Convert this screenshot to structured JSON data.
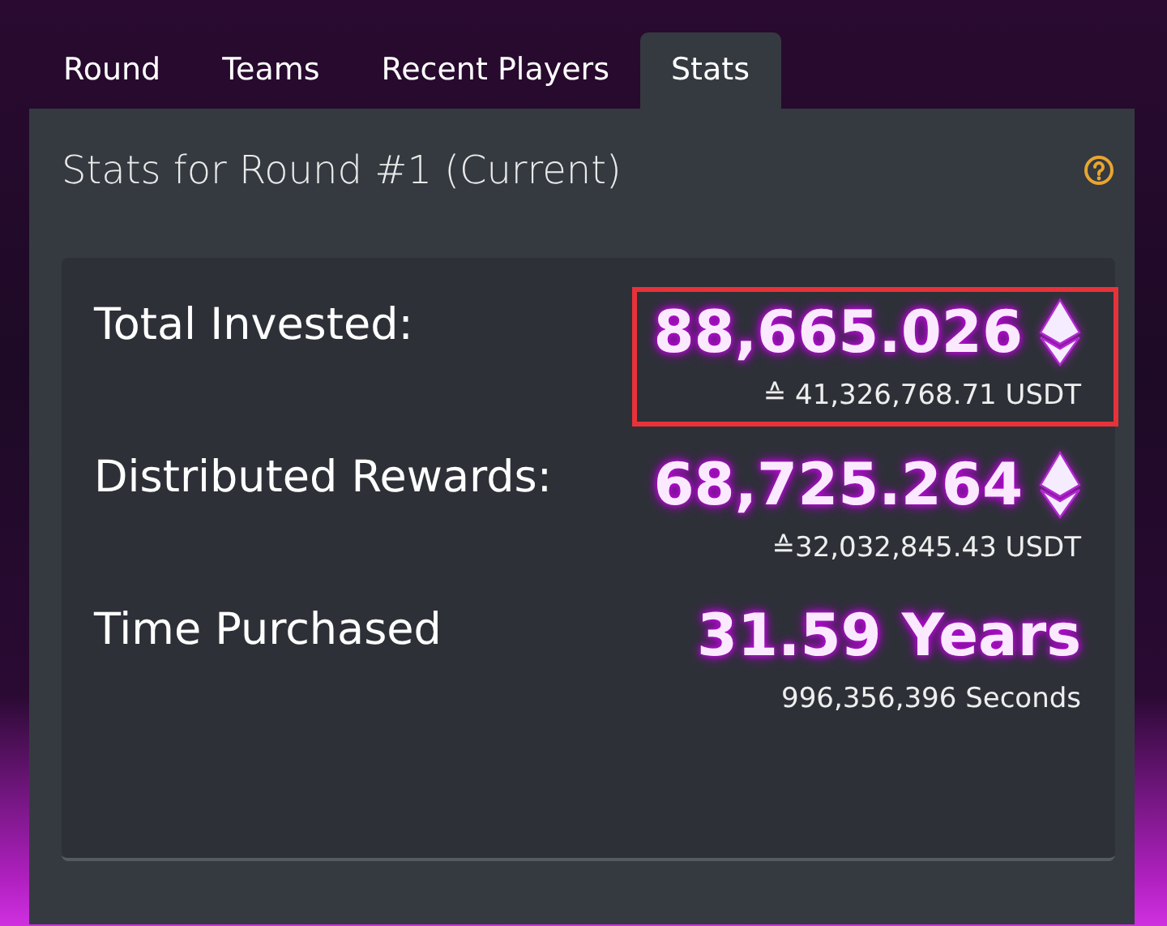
{
  "tabs": [
    {
      "label": "Round",
      "selected": false
    },
    {
      "label": "Teams",
      "selected": false
    },
    {
      "label": "Recent Players",
      "selected": false
    },
    {
      "label": "Stats",
      "selected": true
    }
  ],
  "panel": {
    "title": "Stats for Round #1 (Current)"
  },
  "stats": [
    {
      "label": "Total Invested:",
      "value": "88,665.026",
      "kind": "eth",
      "sub": "≙ 41,326,768.71 USDT",
      "highlighted": true
    },
    {
      "label": "Distributed Rewards:",
      "value": "68,725.264",
      "kind": "eth",
      "sub": "≙32,032,845.43 USDT",
      "highlighted": false
    },
    {
      "label": "Time Purchased",
      "value": "31.59 Years",
      "kind": "plain",
      "sub": "996,356,396 Seconds",
      "highlighted": false
    }
  ]
}
